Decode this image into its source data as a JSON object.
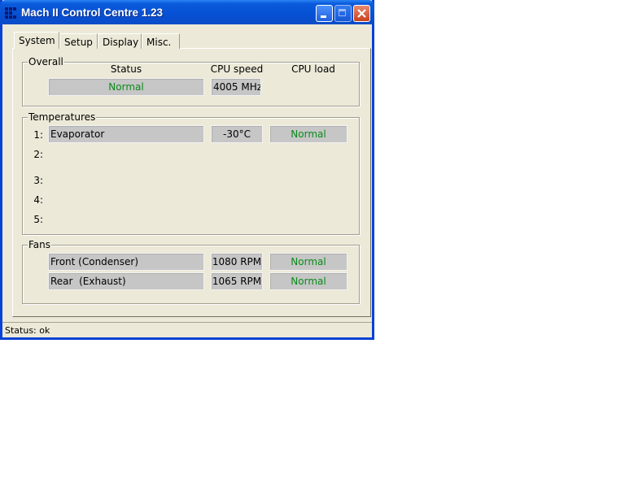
{
  "window": {
    "title": "Mach II Control Centre 1.23",
    "icon": "app-grid-icon"
  },
  "tabs": [
    "System",
    "Setup",
    "Display",
    "Misc."
  ],
  "overall": {
    "legend": "Overall",
    "headers": {
      "status": "Status",
      "cpu_speed": "CPU speed",
      "cpu_load": "CPU load"
    },
    "status": "Normal",
    "cpu_speed": "4005 MHz"
  },
  "temperatures": {
    "legend": "Temperatures",
    "rows": [
      {
        "index": "1:",
        "name": "Evaporator",
        "value": "-30°C",
        "status": "Normal"
      },
      {
        "index": "2:"
      },
      {
        "index": "3:"
      },
      {
        "index": "4:"
      },
      {
        "index": "5:"
      }
    ]
  },
  "fans": {
    "legend": "Fans",
    "rows": [
      {
        "name": "Front (Condenser)",
        "speed": "1080 RPM",
        "status": "Normal"
      },
      {
        "name": "Rear  (Exhaust)",
        "speed": "1065 RPM",
        "status": "Normal"
      }
    ]
  },
  "statusbar": {
    "text": "Status: ok"
  },
  "colors": {
    "titlebar": "#0650d4",
    "ok_green": "#0a8a1a",
    "field_bg": "#c6c6c6",
    "window_bg": "#ece9d8"
  }
}
